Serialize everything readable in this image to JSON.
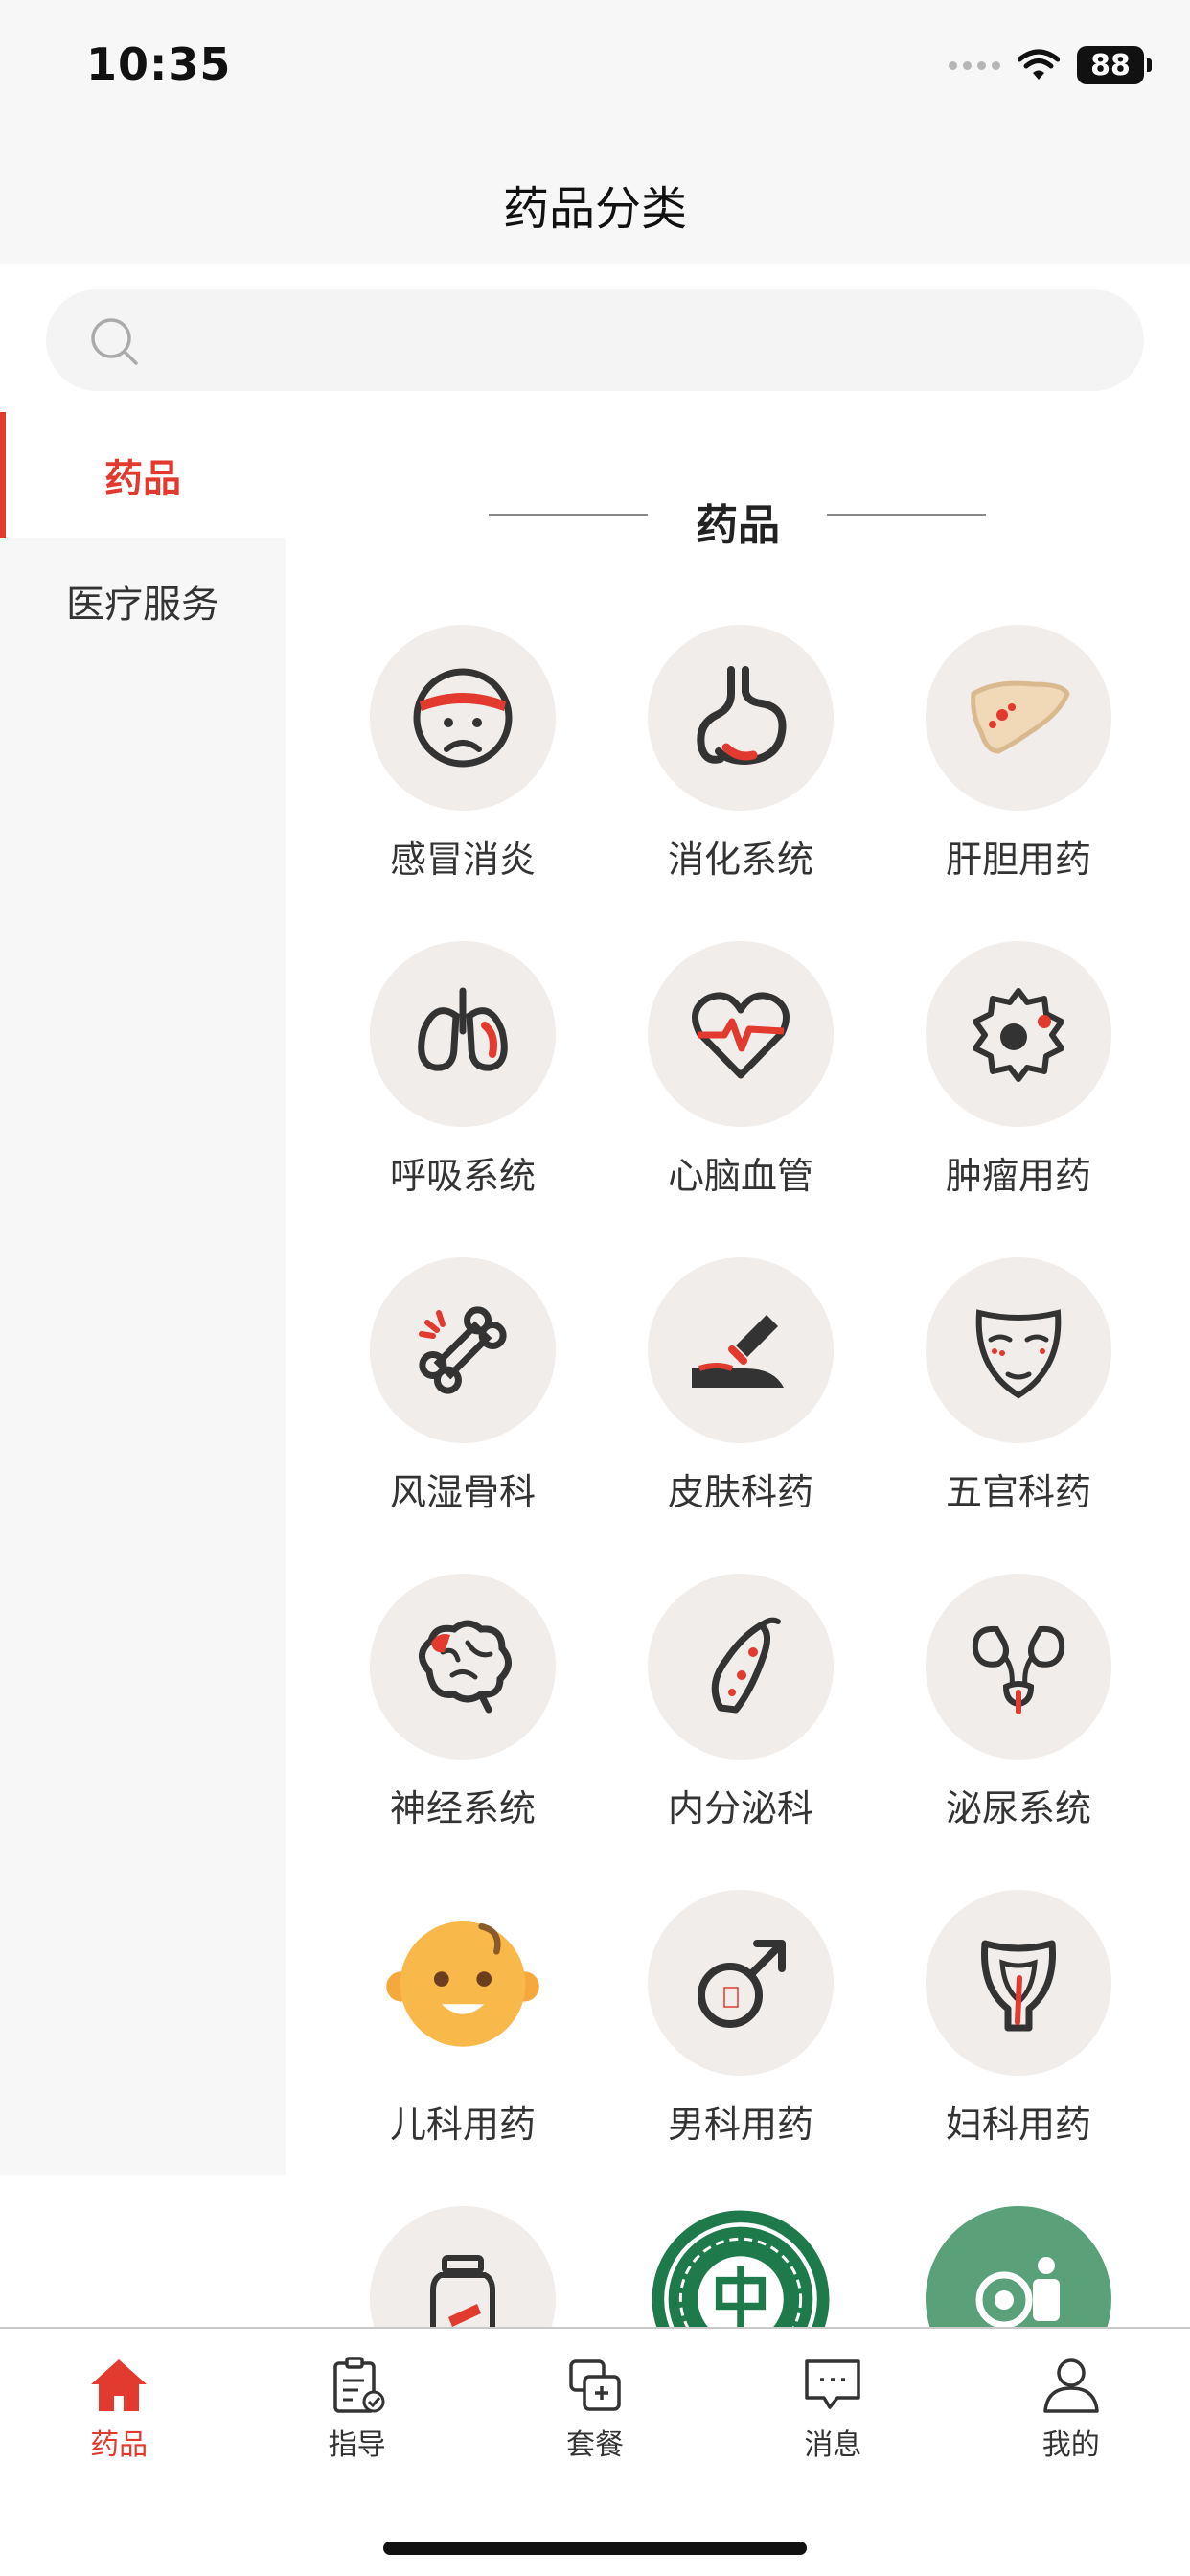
{
  "status": {
    "time": "10:35",
    "battery": "88"
  },
  "nav": {
    "title": "药品分类"
  },
  "search": {
    "placeholder": ""
  },
  "sidebar": {
    "items": [
      {
        "label": "药品"
      },
      {
        "label": "医疗服务"
      }
    ]
  },
  "section": {
    "title": "药品"
  },
  "categories": [
    {
      "label": "感冒消炎",
      "icon": "sick-face-icon"
    },
    {
      "label": "消化系统",
      "icon": "stomach-icon"
    },
    {
      "label": "肝胆用药",
      "icon": "liver-icon"
    },
    {
      "label": "呼吸系统",
      "icon": "lungs-icon"
    },
    {
      "label": "心脑血管",
      "icon": "heart-pulse-icon"
    },
    {
      "label": "肿瘤用药",
      "icon": "tumor-cell-icon"
    },
    {
      "label": "风湿骨科",
      "icon": "bone-icon"
    },
    {
      "label": "皮肤科药",
      "icon": "skin-ointment-icon"
    },
    {
      "label": "五官科药",
      "icon": "face-icon"
    },
    {
      "label": "神经系统",
      "icon": "brain-icon"
    },
    {
      "label": "内分泌科",
      "icon": "endocrine-icon"
    },
    {
      "label": "泌尿系统",
      "icon": "kidney-icon"
    },
    {
      "label": "儿科用药",
      "icon": "baby-face-icon"
    },
    {
      "label": "男科用药",
      "icon": "male-symbol-icon"
    },
    {
      "label": "妇科用药",
      "icon": "uterus-icon"
    },
    {
      "label": "",
      "icon": "medicine-bottle-icon"
    },
    {
      "label": "",
      "icon": "traditional-medicine-emblem-icon"
    },
    {
      "label": "",
      "icon": "medical-device-icon"
    }
  ],
  "tabs": [
    {
      "label": "药品",
      "icon": "home-icon",
      "active": true
    },
    {
      "label": "指导",
      "icon": "clipboard-icon"
    },
    {
      "label": "套餐",
      "icon": "package-icon"
    },
    {
      "label": "消息",
      "icon": "message-icon"
    },
    {
      "label": "我的",
      "icon": "user-icon"
    }
  ],
  "colors": {
    "accent": "#e23a2e",
    "icon_bg": "#f1edea",
    "sidebar_bg": "#f7f7f7",
    "baby_yellow": "#f8b84a",
    "emblem_green": "#1f7a4b"
  }
}
